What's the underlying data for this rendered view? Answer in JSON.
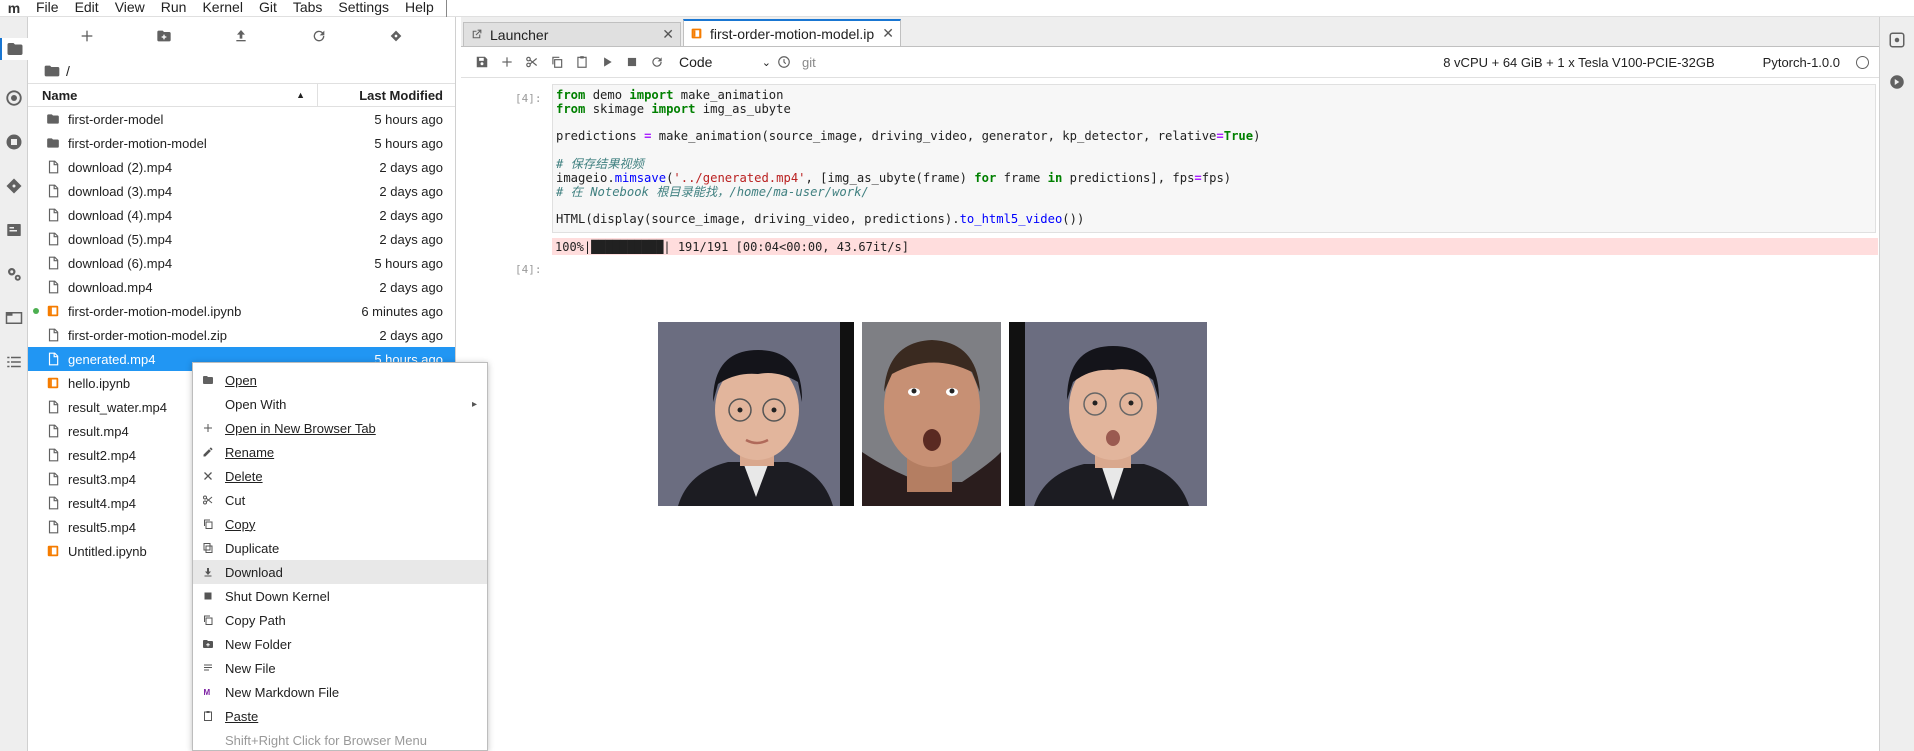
{
  "menubar": {
    "logo": "m",
    "items": [
      "File",
      "Edit",
      "View",
      "Run",
      "Kernel",
      "Git",
      "Tabs",
      "Settings",
      "Help"
    ]
  },
  "filebrowser": {
    "breadcrumb": "/",
    "columns": {
      "name": "Name",
      "modified": "Last Modified"
    },
    "files": [
      {
        "name": "first-order-model",
        "modified": "5 hours ago",
        "icon": "folder-icon"
      },
      {
        "name": "first-order-motion-model",
        "modified": "5 hours ago",
        "icon": "folder-icon"
      },
      {
        "name": "download (2).mp4",
        "modified": "2 days ago",
        "icon": "file-icon"
      },
      {
        "name": "download (3).mp4",
        "modified": "2 days ago",
        "icon": "file-icon"
      },
      {
        "name": "download (4).mp4",
        "modified": "2 days ago",
        "icon": "file-icon"
      },
      {
        "name": "download (5).mp4",
        "modified": "2 days ago",
        "icon": "file-icon"
      },
      {
        "name": "download (6).mp4",
        "modified": "5 hours ago",
        "icon": "file-icon"
      },
      {
        "name": "download.mp4",
        "modified": "2 days ago",
        "icon": "file-icon"
      },
      {
        "name": "first-order-motion-model.ipynb",
        "modified": "6 minutes ago",
        "icon": "notebook-icon",
        "running": true
      },
      {
        "name": "first-order-motion-model.zip",
        "modified": "2 days ago",
        "icon": "file-icon"
      },
      {
        "name": "generated.mp4",
        "modified": "5 hours ago",
        "icon": "file-icon",
        "selected": true
      },
      {
        "name": "hello.ipynb",
        "modified": "",
        "icon": "notebook-icon"
      },
      {
        "name": "result_water.mp4",
        "modified": "",
        "icon": "file-icon"
      },
      {
        "name": "result.mp4",
        "modified": "",
        "icon": "file-icon"
      },
      {
        "name": "result2.mp4",
        "modified": "",
        "icon": "file-icon"
      },
      {
        "name": "result3.mp4",
        "modified": "",
        "icon": "file-icon"
      },
      {
        "name": "result4.mp4",
        "modified": "",
        "icon": "file-icon"
      },
      {
        "name": "result5.mp4",
        "modified": "",
        "icon": "file-icon"
      },
      {
        "name": "Untitled.ipynb",
        "modified": "",
        "icon": "notebook-icon"
      }
    ]
  },
  "tabs": [
    {
      "label": "Launcher",
      "icon": "launcher-icon",
      "active": false
    },
    {
      "label": "first-order-motion-model.ip",
      "icon": "notebook-icon",
      "active": true
    }
  ],
  "notebook_toolbar": {
    "cell_type": "Code",
    "git": "git",
    "resources": "8 vCPU + 64 GiB + 1 x Tesla V100-PCIE-32GB",
    "kernel": "Pytorch-1.0.0"
  },
  "cells": {
    "input_prompt": "[4]:",
    "output_prompt": "[4]:",
    "code_lines": [
      "from demo import make_animation",
      "from skimage import img_as_ubyte",
      "",
      "predictions = make_animation(source_image, driving_video, generator, kp_detector, relative=True)",
      "",
      "# 保存结果视频",
      "imageio.mimsave('../generated.mp4', [img_as_ubyte(frame) for frame in predictions], fps=fps)",
      "# 在 Notebook 根目录能找，/home/ma-user/work/",
      "",
      "HTML(display(source_image, driving_video, predictions).to_html5_video())"
    ],
    "stderr": "100%|██████████| 191/191 [00:04<00:00, 43.67it/s]"
  },
  "context_menu": {
    "items": [
      {
        "label": "Open",
        "icon": "folder-icon",
        "underline": "O"
      },
      {
        "label": "Open With",
        "icon": "",
        "submenu": true
      },
      {
        "label": "Open in New Browser Tab",
        "icon": "plus-icon",
        "underline": "O"
      },
      {
        "label": "Rename",
        "icon": "edit-icon",
        "underline": "R"
      },
      {
        "label": "Delete",
        "icon": "close-icon",
        "underline": "D"
      },
      {
        "label": "Cut",
        "icon": "cut-icon"
      },
      {
        "label": "Copy",
        "icon": "copy-icon",
        "underline": "C"
      },
      {
        "label": "Duplicate",
        "icon": "duplicate-icon"
      },
      {
        "label": "Download",
        "icon": "download-icon",
        "highlight": true
      },
      {
        "label": "Shut Down Kernel",
        "icon": "stop-icon"
      },
      {
        "label": "Copy Path",
        "icon": "copy-path-icon"
      },
      {
        "label": "New Folder",
        "icon": "new-folder-icon"
      },
      {
        "label": "New File",
        "icon": "new-file-icon"
      },
      {
        "label": "New Markdown File",
        "icon": "markdown-icon"
      },
      {
        "label": "Paste",
        "icon": "paste-icon",
        "underline": "P"
      },
      {
        "label": "Shift+Right Click for Browser Menu",
        "icon": "",
        "disabled": true
      }
    ]
  },
  "colors": {
    "accent": "#2196f3",
    "tab_accent": "#1976d2",
    "notebook_orange": "#f57c00",
    "stderr_bg": "#ffdddd",
    "running_dot": "#4caf50"
  }
}
